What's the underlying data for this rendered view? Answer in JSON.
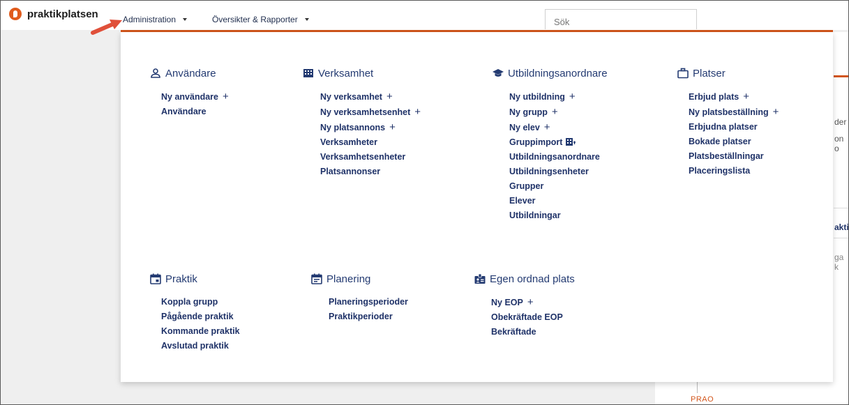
{
  "brand": {
    "name": "praktikplatsen",
    "color": "#e05b1c"
  },
  "nav": {
    "administration": "Administration",
    "reports": "Översikter & Rapporter",
    "search_placeholder": "Sök"
  },
  "background": {
    "snippets": [
      "der",
      "on o",
      "aktik",
      "ga k"
    ],
    "timeline_label": "PRAO"
  },
  "menu": {
    "anvandare": {
      "title": "Användare",
      "icon": "person-icon",
      "links": [
        {
          "label": "Ny användare",
          "plus": "+"
        },
        {
          "label": "Användare"
        }
      ]
    },
    "verksamhet": {
      "title": "Verksamhet",
      "icon": "building-icon",
      "links": [
        {
          "label": "Ny verksamhet",
          "plus": "+"
        },
        {
          "label": "Ny verksamhetsenhet",
          "plus": "+"
        },
        {
          "label": "Ny platsannons",
          "plus": "+"
        },
        {
          "label": "Verksamheter"
        },
        {
          "label": "Verksamhetsenheter"
        },
        {
          "label": "Platsannonser"
        }
      ]
    },
    "utbildning": {
      "title": "Utbildningsanordnare",
      "icon": "graduation-cap-icon",
      "links": [
        {
          "label": "Ny utbildning",
          "plus": "+"
        },
        {
          "label": "Ny grupp",
          "plus": "+"
        },
        {
          "label": "Ny elev",
          "plus": "+"
        },
        {
          "label": "Gruppimport"
        },
        {
          "label": "Utbildningsanordnare"
        },
        {
          "label": "Utbildningsenheter"
        },
        {
          "label": "Grupper"
        },
        {
          "label": "Elever"
        },
        {
          "label": "Utbildningar"
        }
      ]
    },
    "platser": {
      "title": "Platser",
      "icon": "briefcase-icon",
      "links": [
        {
          "label": "Erbjud plats",
          "plus": "+"
        },
        {
          "label": "Ny platsbeställning",
          "plus": "+"
        },
        {
          "label": "Erbjudna platser"
        },
        {
          "label": "Bokade platser"
        },
        {
          "label": "Platsbeställningar"
        },
        {
          "label": "Placeringslista"
        }
      ]
    },
    "praktik": {
      "title": "Praktik",
      "icon": "calendar-icon",
      "links": [
        {
          "label": "Koppla grupp"
        },
        {
          "label": "Pågående praktik"
        },
        {
          "label": "Kommande praktik"
        },
        {
          "label": "Avslutad praktik"
        }
      ]
    },
    "planering": {
      "title": "Planering",
      "icon": "calendar-notes-icon",
      "links": [
        {
          "label": "Planeringsperioder"
        },
        {
          "label": "Praktikperioder"
        }
      ]
    },
    "eop": {
      "title": "Egen ordnad plats",
      "icon": "id-badge-icon",
      "links": [
        {
          "label": "Ny EOP",
          "plus": "+"
        },
        {
          "label": "Obekräftade EOP"
        },
        {
          "label": "Bekräftade"
        }
      ]
    }
  }
}
